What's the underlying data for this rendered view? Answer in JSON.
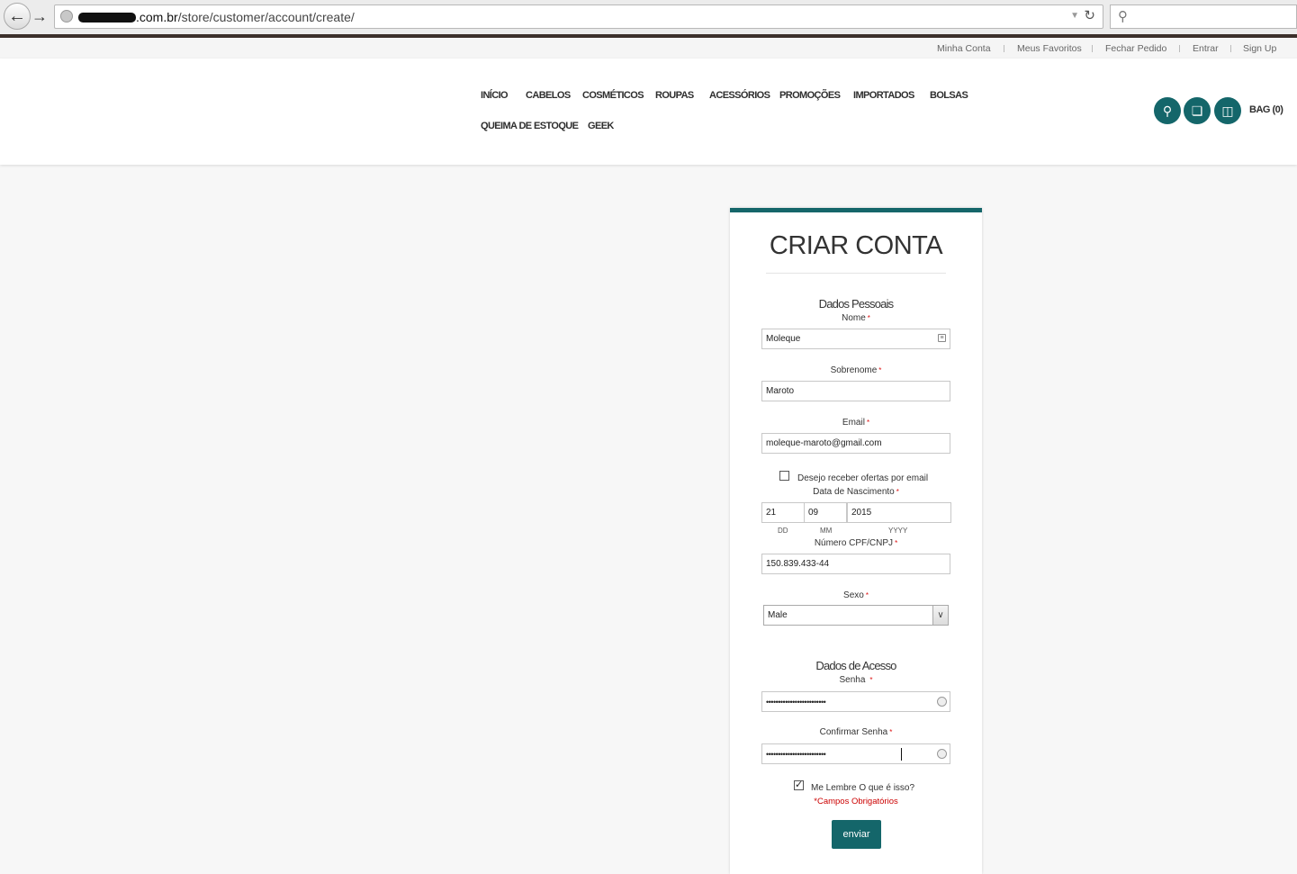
{
  "browser": {
    "url_host": ".com.br",
    "url_path": "/store/customer/account/create/"
  },
  "top_links": [
    "Minha Conta",
    "Meus Favoritos",
    "Fechar Pedido",
    "Entrar",
    "Sign Up"
  ],
  "menu": {
    "row1": [
      "INÍCIO",
      "CABELOS",
      "COSMÉTICOS",
      "ROUPAS",
      "ACESSÓRIOS",
      "PROMOÇÕES",
      "IMPORTADOS",
      "BOLSAS"
    ],
    "row2": [
      "QUEIMA DE ESTOQUE",
      "GEEK"
    ]
  },
  "bag_label": "BAG (0)",
  "form": {
    "title": "CRIAR CONTA",
    "personal_section": "Dados Pessoais",
    "nome_label": "Nome",
    "nome_value": "Moleque",
    "sobrenome_label": "Sobrenome",
    "sobrenome_value": "Maroto",
    "email_label": "Email",
    "email_value": "moleque-maroto@gmail.com",
    "newsletter_label": "Desejo receber ofertas por email",
    "newsletter_checked": false,
    "dob_label": "Data de Nascimento",
    "dob_day": "21",
    "dob_month": "09",
    "dob_year": "2015",
    "dob_day_hint": "DD",
    "dob_month_hint": "MM",
    "dob_year_hint": "YYYY",
    "cpf_label": "Número CPF/CNPJ",
    "cpf_value": "150.839.433-44",
    "sexo_label": "Sexo",
    "sexo_value": "Male",
    "access_section": "Dados de Acesso",
    "senha_label": "Senha",
    "senha_value": "•••••••••••••••••••••••••",
    "confirm_label": "Confirmar Senha",
    "confirm_value": "•••••••••••••••••••••••••",
    "remember_label": "Me Lembre O que é isso?",
    "remember_checked": true,
    "required_note": "*Campos Obrigatórios",
    "required_mark": "*",
    "submit_label": "enviar"
  },
  "colors": {
    "accent": "#14666a",
    "required": "#cc0000"
  }
}
